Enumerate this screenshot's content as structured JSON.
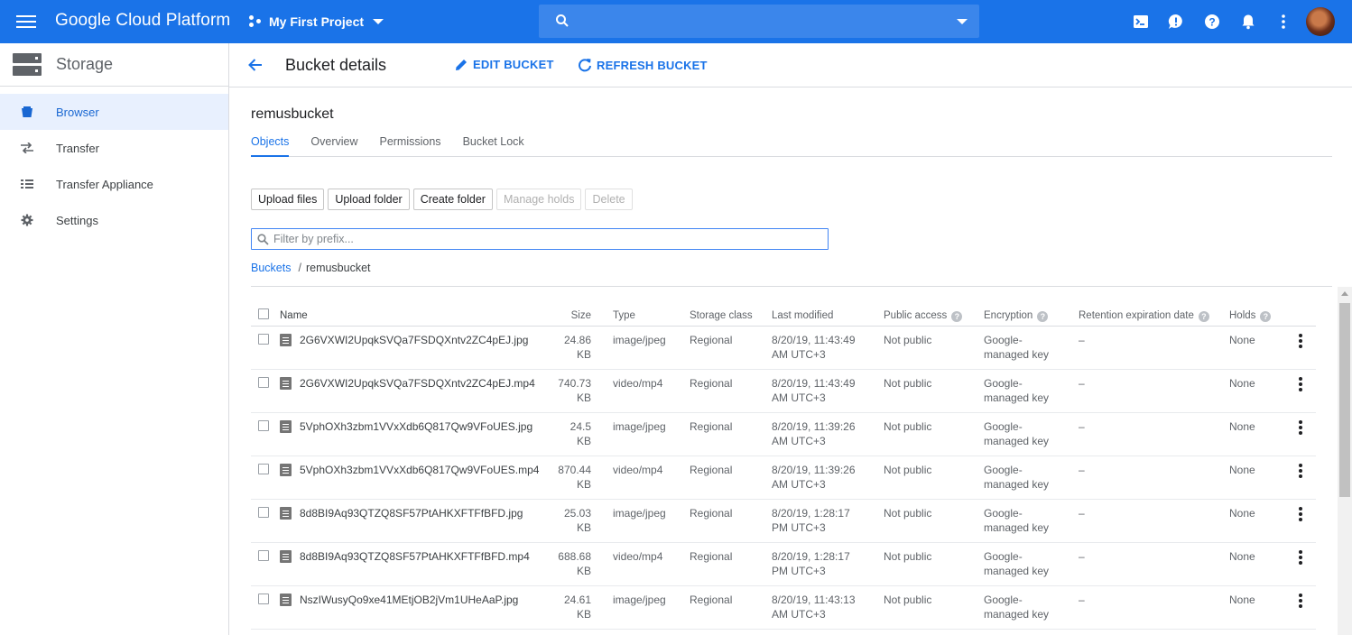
{
  "topbar": {
    "brand": "Google Cloud Platform",
    "project": "My First Project",
    "colors": {
      "bar": "#1a73e8",
      "search": "#3b86eb"
    },
    "icons": [
      "cloud-shell-icon",
      "feedback-icon",
      "help-icon",
      "notifications-icon",
      "more-vert-icon"
    ]
  },
  "sidebar": {
    "title": "Storage",
    "items": [
      {
        "label": "Browser",
        "icon": "bucket-icon",
        "active": true
      },
      {
        "label": "Transfer",
        "icon": "transfer-icon",
        "active": false
      },
      {
        "label": "Transfer Appliance",
        "icon": "transfer-appliance-icon",
        "active": false
      },
      {
        "label": "Settings",
        "icon": "gear-icon",
        "active": false
      }
    ]
  },
  "header": {
    "title": "Bucket details",
    "edit": "EDIT BUCKET",
    "refresh": "REFRESH BUCKET"
  },
  "bucket": {
    "name": "remusbucket"
  },
  "tabs": [
    {
      "label": "Objects",
      "active": true
    },
    {
      "label": "Overview",
      "active": false
    },
    {
      "label": "Permissions",
      "active": false
    },
    {
      "label": "Bucket Lock",
      "active": false
    }
  ],
  "actions": {
    "upload_files": "Upload files",
    "upload_folder": "Upload folder",
    "create_folder": "Create folder",
    "manage_holds": "Manage holds",
    "delete": "Delete"
  },
  "filter": {
    "placeholder": "Filter by prefix...",
    "value": ""
  },
  "breadcrumb": {
    "root": "Buckets",
    "separator": "/",
    "current": "remusbucket"
  },
  "table": {
    "headers": {
      "name": "Name",
      "size": "Size",
      "type": "Type",
      "storage_class": "Storage class",
      "last_modified": "Last modified",
      "public_access": "Public access",
      "encryption": "Encryption",
      "retention": "Retention expiration date",
      "holds": "Holds"
    },
    "rows": [
      {
        "name": "2G6VXWI2UpqkSVQa7FSDQXntv2ZC4pEJ.jpg",
        "size1": "24.86",
        "size2": "KB",
        "type": "image/jpeg",
        "class": "Regional",
        "mod1": "8/20/19, 11:43:49",
        "mod2": "AM UTC+3",
        "public": "Not public",
        "enc1": "Google-",
        "enc2": "managed key",
        "retention": "–",
        "holds": "None"
      },
      {
        "name": "2G6VXWI2UpqkSVQa7FSDQXntv2ZC4pEJ.mp4",
        "size1": "740.73",
        "size2": "KB",
        "type": "video/mp4",
        "class": "Regional",
        "mod1": "8/20/19, 11:43:49",
        "mod2": "AM UTC+3",
        "public": "Not public",
        "enc1": "Google-",
        "enc2": "managed key",
        "retention": "–",
        "holds": "None"
      },
      {
        "name": "5VphOXh3zbm1VVxXdb6Q817Qw9VFoUES.jpg",
        "size1": "24.5",
        "size2": "KB",
        "type": "image/jpeg",
        "class": "Regional",
        "mod1": "8/20/19, 11:39:26",
        "mod2": "AM UTC+3",
        "public": "Not public",
        "enc1": "Google-",
        "enc2": "managed key",
        "retention": "–",
        "holds": "None"
      },
      {
        "name": "5VphOXh3zbm1VVxXdb6Q817Qw9VFoUES.mp4",
        "size1": "870.44",
        "size2": "KB",
        "type": "video/mp4",
        "class": "Regional",
        "mod1": "8/20/19, 11:39:26",
        "mod2": "AM UTC+3",
        "public": "Not public",
        "enc1": "Google-",
        "enc2": "managed key",
        "retention": "–",
        "holds": "None"
      },
      {
        "name": "8d8BI9Aq93QTZQ8SF57PtAHKXFTFfBFD.jpg",
        "size1": "25.03",
        "size2": "KB",
        "type": "image/jpeg",
        "class": "Regional",
        "mod1": "8/20/19, 1:28:17",
        "mod2": "PM UTC+3",
        "public": "Not public",
        "enc1": "Google-",
        "enc2": "managed key",
        "retention": "–",
        "holds": "None"
      },
      {
        "name": "8d8BI9Aq93QTZQ8SF57PtAHKXFTFfBFD.mp4",
        "size1": "688.68",
        "size2": "KB",
        "type": "video/mp4",
        "class": "Regional",
        "mod1": "8/20/19, 1:28:17",
        "mod2": "PM UTC+3",
        "public": "Not public",
        "enc1": "Google-",
        "enc2": "managed key",
        "retention": "–",
        "holds": "None"
      },
      {
        "name": "NszIWusyQo9xe41MEtjOB2jVm1UHeAaP.jpg",
        "size1": "24.61",
        "size2": "KB",
        "type": "image/jpeg",
        "class": "Regional",
        "mod1": "8/20/19, 11:43:13",
        "mod2": "AM UTC+3",
        "public": "Not public",
        "enc1": "Google-",
        "enc2": "managed key",
        "retention": "–",
        "holds": "None"
      }
    ]
  }
}
